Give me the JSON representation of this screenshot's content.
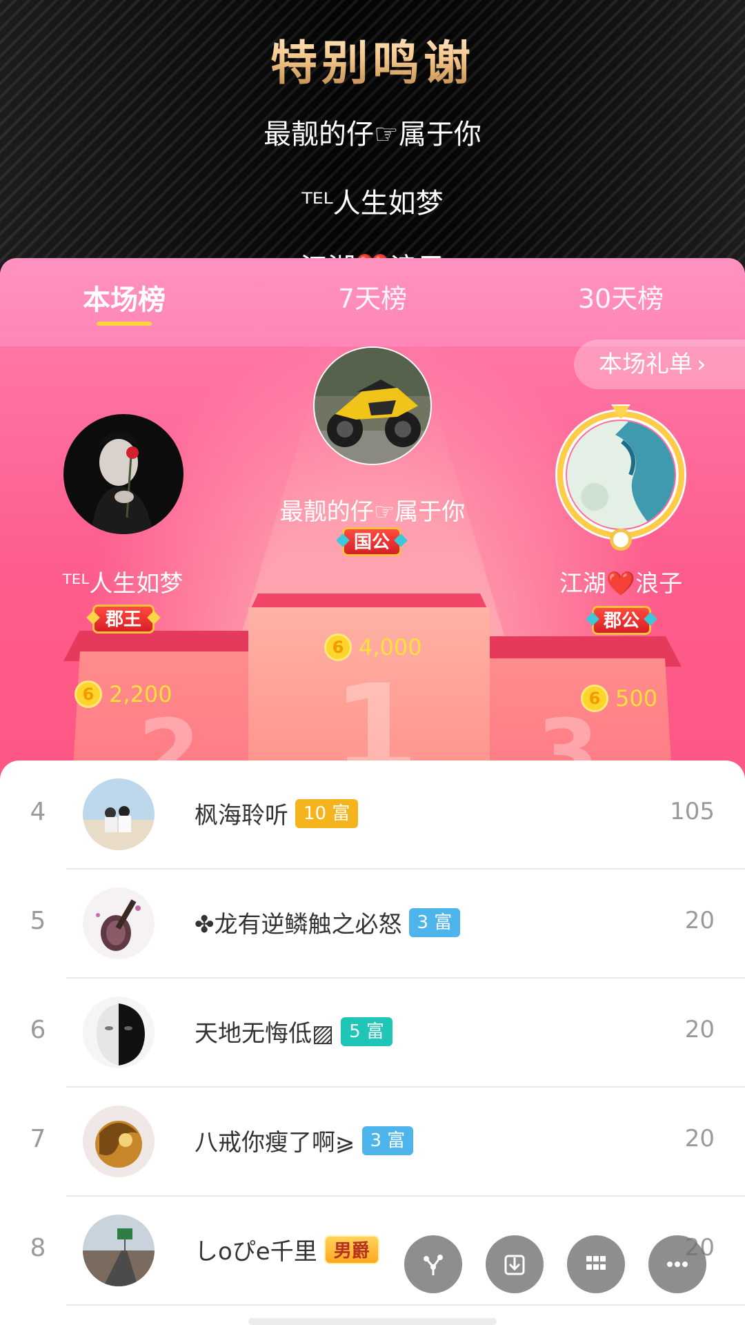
{
  "credits": {
    "title": "特别鸣谢",
    "lines": [
      "最靓的仔☞属于你",
      "ᵀᴱᴸ人生如梦",
      "江湖❤️浪子"
    ]
  },
  "tabs": [
    {
      "label": "本场榜",
      "active": true
    },
    {
      "label": "7天榜",
      "active": false
    },
    {
      "label": "30天榜",
      "active": false
    }
  ],
  "gift_link": {
    "label": "本场礼单",
    "icon": "chevron-right-icon"
  },
  "podium": {
    "first": {
      "rank": 1,
      "name": "最靓的仔☞属于你",
      "badge": "国公",
      "coins": "4,000"
    },
    "second": {
      "rank": 2,
      "name": "ᵀᴱᴸ人生如梦",
      "badge": "郡王",
      "coins": "2,200"
    },
    "third": {
      "rank": 3,
      "name": "江湖❤️浪子",
      "badge": "郡公",
      "coins": "500"
    }
  },
  "list": [
    {
      "rank": "4",
      "name": "枫海聆听",
      "level": "10 富",
      "level_color": "#f5b41e",
      "score": "105"
    },
    {
      "rank": "5",
      "name": "✤龙有逆鳞触之必怒",
      "level": "3 富",
      "level_color": "#4db5ec",
      "score": "20"
    },
    {
      "rank": "6",
      "name": "天地无悔低▨",
      "level": "5 富",
      "level_color": "#1fc5b5",
      "score": "20"
    },
    {
      "rank": "7",
      "name": "八戒你瘦了啊⪀",
      "level": "3 富",
      "level_color": "#4db5ec",
      "score": "20"
    },
    {
      "rank": "8",
      "name": "しoぴe千里",
      "level": "男爵",
      "level_color": "#ffb52e",
      "score": "20"
    }
  ],
  "coin_symbol": "6",
  "fabs": [
    "share-icon",
    "download-icon",
    "grid-icon",
    "more-icon"
  ]
}
